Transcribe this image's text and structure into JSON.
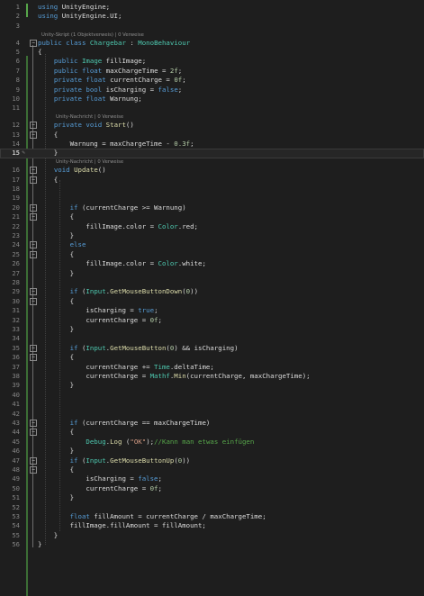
{
  "hints": {
    "class": "Unity-Skript (1 Objektverweis) | 0 Verweise",
    "start": "Unity-Nachricht | 0 Verweise",
    "update": "Unity-Nachricht | 0 Verweise"
  },
  "current_line": 15,
  "lines": [
    {
      "n": 1,
      "segs": [
        [
          "kw",
          "using"
        ],
        [
          "tx",
          " UnityEngine;"
        ]
      ]
    },
    {
      "n": 2,
      "segs": [
        [
          "kw",
          "using"
        ],
        [
          "tx",
          " UnityEngine.UI;"
        ]
      ]
    },
    {
      "n": 3,
      "segs": []
    },
    {
      "n": 4,
      "segs": [
        [
          "kw",
          "public class"
        ],
        [
          "tx",
          " "
        ],
        [
          "ty",
          "Chargebar"
        ],
        [
          "tx",
          " : "
        ],
        [
          "ty",
          "MonoBehaviour"
        ]
      ]
    },
    {
      "n": 5,
      "segs": [
        [
          "tx",
          "{"
        ]
      ]
    },
    {
      "n": 6,
      "segs": [
        [
          "tx",
          "    "
        ],
        [
          "kw",
          "public"
        ],
        [
          "tx",
          " "
        ],
        [
          "ty",
          "Image"
        ],
        [
          "tx",
          " fillImage;"
        ]
      ]
    },
    {
      "n": 7,
      "segs": [
        [
          "tx",
          "    "
        ],
        [
          "kw",
          "public float"
        ],
        [
          "tx",
          " maxChargeTime = "
        ],
        [
          "nm",
          "2f"
        ],
        [
          "tx",
          ";"
        ]
      ]
    },
    {
      "n": 8,
      "segs": [
        [
          "tx",
          "    "
        ],
        [
          "kw",
          "private float"
        ],
        [
          "tx",
          " currentCharge = "
        ],
        [
          "nm",
          "0f"
        ],
        [
          "tx",
          ";"
        ]
      ]
    },
    {
      "n": 9,
      "segs": [
        [
          "tx",
          "    "
        ],
        [
          "kw",
          "private bool"
        ],
        [
          "tx",
          " isCharging = "
        ],
        [
          "kw",
          "false"
        ],
        [
          "tx",
          ";"
        ]
      ]
    },
    {
      "n": 10,
      "segs": [
        [
          "tx",
          "    "
        ],
        [
          "kw",
          "private float"
        ],
        [
          "tx",
          " Warnung;"
        ]
      ]
    },
    {
      "n": 11,
      "segs": []
    },
    {
      "n": 12,
      "segs": [
        [
          "tx",
          "    "
        ],
        [
          "kw",
          "private void"
        ],
        [
          "tx",
          " "
        ],
        [
          "mt",
          "Start"
        ],
        [
          "tx",
          "()"
        ]
      ]
    },
    {
      "n": 13,
      "segs": [
        [
          "tx",
          "    {"
        ]
      ]
    },
    {
      "n": 14,
      "segs": [
        [
          "tx",
          "        Warnung = maxChargeTime - "
        ],
        [
          "nm",
          "0.3f"
        ],
        [
          "tx",
          ";"
        ]
      ]
    },
    {
      "n": 15,
      "segs": [
        [
          "tx",
          "    }"
        ]
      ]
    },
    {
      "n": 16,
      "segs": [
        [
          "tx",
          "    "
        ],
        [
          "kw",
          "void"
        ],
        [
          "tx",
          " "
        ],
        [
          "mt",
          "Update"
        ],
        [
          "tx",
          "()"
        ]
      ]
    },
    {
      "n": 17,
      "segs": [
        [
          "tx",
          "    {"
        ]
      ]
    },
    {
      "n": 18,
      "segs": []
    },
    {
      "n": 19,
      "segs": []
    },
    {
      "n": 20,
      "segs": [
        [
          "tx",
          "        "
        ],
        [
          "kw",
          "if"
        ],
        [
          "tx",
          " (currentCharge >= Warnung)"
        ]
      ]
    },
    {
      "n": 21,
      "segs": [
        [
          "tx",
          "        {"
        ]
      ]
    },
    {
      "n": 22,
      "segs": [
        [
          "tx",
          "            fillImage.color = "
        ],
        [
          "ty",
          "Color"
        ],
        [
          "tx",
          ".red;"
        ]
      ]
    },
    {
      "n": 23,
      "segs": [
        [
          "tx",
          "        }"
        ]
      ]
    },
    {
      "n": 24,
      "segs": [
        [
          "tx",
          "        "
        ],
        [
          "kw",
          "else"
        ]
      ]
    },
    {
      "n": 25,
      "segs": [
        [
          "tx",
          "        {"
        ]
      ]
    },
    {
      "n": 26,
      "segs": [
        [
          "tx",
          "            fillImage.color = "
        ],
        [
          "ty",
          "Color"
        ],
        [
          "tx",
          ".white;"
        ]
      ]
    },
    {
      "n": 27,
      "segs": [
        [
          "tx",
          "        }"
        ]
      ]
    },
    {
      "n": 28,
      "segs": []
    },
    {
      "n": 29,
      "segs": [
        [
          "tx",
          "        "
        ],
        [
          "kw",
          "if"
        ],
        [
          "tx",
          " ("
        ],
        [
          "ty",
          "Input"
        ],
        [
          "tx",
          "."
        ],
        [
          "mt",
          "GetMouseButtonDown"
        ],
        [
          "tx",
          "("
        ],
        [
          "nm",
          "0"
        ],
        [
          "tx",
          "))"
        ]
      ]
    },
    {
      "n": 30,
      "segs": [
        [
          "tx",
          "        {"
        ]
      ]
    },
    {
      "n": 31,
      "segs": [
        [
          "tx",
          "            isCharging = "
        ],
        [
          "kw",
          "true"
        ],
        [
          "tx",
          ";"
        ]
      ]
    },
    {
      "n": 32,
      "segs": [
        [
          "tx",
          "            currentCharge = "
        ],
        [
          "nm",
          "0f"
        ],
        [
          "tx",
          ";"
        ]
      ]
    },
    {
      "n": 33,
      "segs": [
        [
          "tx",
          "        }"
        ]
      ]
    },
    {
      "n": 34,
      "segs": []
    },
    {
      "n": 35,
      "segs": [
        [
          "tx",
          "        "
        ],
        [
          "kw",
          "if"
        ],
        [
          "tx",
          " ("
        ],
        [
          "ty",
          "Input"
        ],
        [
          "tx",
          "."
        ],
        [
          "mt",
          "GetMouseButton"
        ],
        [
          "tx",
          "("
        ],
        [
          "nm",
          "0"
        ],
        [
          "tx",
          ") && isCharging)"
        ]
      ]
    },
    {
      "n": 36,
      "segs": [
        [
          "tx",
          "        {"
        ]
      ]
    },
    {
      "n": 37,
      "segs": [
        [
          "tx",
          "            currentCharge += "
        ],
        [
          "ty",
          "Time"
        ],
        [
          "tx",
          ".deltaTime;"
        ]
      ]
    },
    {
      "n": 38,
      "segs": [
        [
          "tx",
          "            currentCharge = "
        ],
        [
          "ty",
          "Mathf"
        ],
        [
          "tx",
          "."
        ],
        [
          "mt",
          "Min"
        ],
        [
          "tx",
          "(currentCharge, maxChargeTime);"
        ]
      ]
    },
    {
      "n": 39,
      "segs": [
        [
          "tx",
          "        }"
        ]
      ]
    },
    {
      "n": 40,
      "segs": []
    },
    {
      "n": 41,
      "segs": []
    },
    {
      "n": 42,
      "segs": []
    },
    {
      "n": 43,
      "segs": [
        [
          "tx",
          "        "
        ],
        [
          "kw",
          "if"
        ],
        [
          "tx",
          " (currentCharge == maxChargeTime)"
        ]
      ]
    },
    {
      "n": 44,
      "segs": [
        [
          "tx",
          "        {"
        ]
      ]
    },
    {
      "n": 45,
      "segs": [
        [
          "tx",
          "            "
        ],
        [
          "ty",
          "Debug"
        ],
        [
          "tx",
          "."
        ],
        [
          "mt",
          "Log"
        ],
        [
          "tx",
          " ("
        ],
        [
          "st",
          "\"OK\""
        ],
        [
          "tx",
          ");"
        ],
        [
          "cm",
          "//Kann man etwas einfügen"
        ]
      ]
    },
    {
      "n": 46,
      "segs": [
        [
          "tx",
          "        }"
        ]
      ]
    },
    {
      "n": 47,
      "segs": [
        [
          "tx",
          "        "
        ],
        [
          "kw",
          "if"
        ],
        [
          "tx",
          " ("
        ],
        [
          "ty",
          "Input"
        ],
        [
          "tx",
          "."
        ],
        [
          "mt",
          "GetMouseButtonUp"
        ],
        [
          "tx",
          "("
        ],
        [
          "nm",
          "0"
        ],
        [
          "tx",
          "))"
        ]
      ]
    },
    {
      "n": 48,
      "segs": [
        [
          "tx",
          "        {"
        ]
      ]
    },
    {
      "n": 49,
      "segs": [
        [
          "tx",
          "            isCharging = "
        ],
        [
          "kw",
          "false"
        ],
        [
          "tx",
          ";"
        ]
      ]
    },
    {
      "n": 50,
      "segs": [
        [
          "tx",
          "            currentCharge = "
        ],
        [
          "nm",
          "0f"
        ],
        [
          "tx",
          ";"
        ]
      ]
    },
    {
      "n": 51,
      "segs": [
        [
          "tx",
          "        }"
        ]
      ]
    },
    {
      "n": 52,
      "segs": []
    },
    {
      "n": 53,
      "segs": [
        [
          "tx",
          "        "
        ],
        [
          "kw",
          "float"
        ],
        [
          "tx",
          " fillAmount = currentCharge / maxChargeTime;"
        ]
      ]
    },
    {
      "n": 54,
      "segs": [
        [
          "tx",
          "        fillImage.fillAmount = fillAmount;"
        ]
      ]
    },
    {
      "n": 55,
      "segs": [
        [
          "tx",
          "    }"
        ]
      ]
    },
    {
      "n": 56,
      "segs": [
        [
          "tx",
          "}"
        ]
      ]
    }
  ]
}
